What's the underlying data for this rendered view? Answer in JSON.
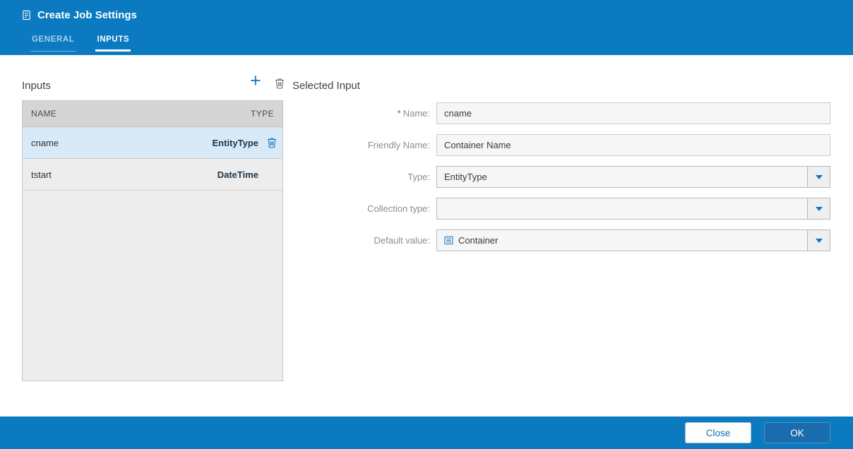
{
  "window": {
    "title": "Create Job Settings"
  },
  "tabs": [
    {
      "label": "GENERAL",
      "active": false
    },
    {
      "label": "INPUTS",
      "active": true
    }
  ],
  "inputs_panel": {
    "title": "Inputs",
    "columns": [
      "NAME",
      "TYPE"
    ],
    "rows": [
      {
        "name": "cname",
        "type": "EntityType",
        "selected": true
      },
      {
        "name": "tstart",
        "type": "DateTime",
        "selected": false
      }
    ]
  },
  "selected_input": {
    "title": "Selected Input",
    "fields": {
      "name": {
        "label": "Name:",
        "required_marker": "*",
        "value": "cname"
      },
      "friendly_name": {
        "label": "Friendly Name:",
        "value": "Container Name"
      },
      "type": {
        "label": "Type:",
        "value": "EntityType"
      },
      "collection_type": {
        "label": "Collection type:",
        "value": ""
      },
      "default_value": {
        "label": "Default value:",
        "value": "Container"
      }
    }
  },
  "footer": {
    "close_label": "Close",
    "ok_label": "OK"
  },
  "icons": {
    "plus_glyph": "+",
    "title_icon": "document-icon",
    "trash_icon": "trash-icon",
    "caret_icon": "chevron-down-icon",
    "default_value_icon": "list-icon"
  },
  "colors": {
    "header_blue": "#0b7ac1",
    "selection_blue": "#d8e9f7",
    "accent_blue": "#1a73b5",
    "ok_button_blue": "#1b6cac"
  }
}
